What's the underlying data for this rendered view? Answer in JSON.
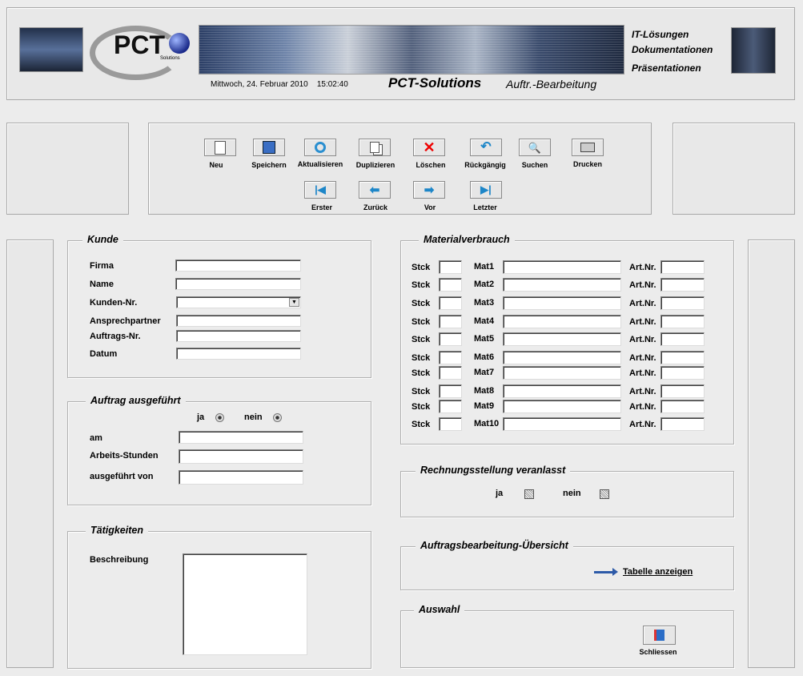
{
  "header": {
    "logo_text": "PCT",
    "logo_sub": "Solutions",
    "datetime": "Mittwoch, 24. Februar 2010    15:02:40",
    "brand": "PCT-Solutions",
    "subtitle": "Auftr.-Bearbeitung",
    "services": [
      "IT-Lösungen",
      "Dokumentationen",
      "Präsentationen"
    ]
  },
  "toolbar": {
    "row1": [
      "Neu",
      "Speichern",
      "Aktualisieren",
      "Duplizieren",
      "Löschen",
      "Rückgängig",
      "Suchen",
      "Drucken"
    ],
    "row2": [
      "Erster",
      "Zurück",
      "Vor",
      "Letzter"
    ]
  },
  "kunde": {
    "title": "Kunde",
    "firma": "Firma",
    "name": "Name",
    "kunden_nr": "Kunden-Nr.",
    "ansprechpartner": "Ansprechpartner",
    "auftrags_nr": "Auftrags-Nr.",
    "datum": "Datum"
  },
  "auftrag": {
    "title": "Auftrag ausgeführt",
    "ja": "ja",
    "nein": "nein",
    "am": "am",
    "stunden": "Arbeits-Stunden",
    "von": "ausgeführt von"
  },
  "taetigkeiten": {
    "title": "Tätigkeiten",
    "beschreibung": "Beschreibung"
  },
  "material": {
    "title": "Materialverbrauch",
    "stck": "Stck",
    "artnr": "Art.Nr.",
    "rows": [
      "Mat1",
      "Mat2",
      "Mat3",
      "Mat4",
      "Mat5",
      "Mat6",
      "Mat7",
      "Mat8",
      "Mat9",
      "Mat10"
    ]
  },
  "rechnung": {
    "title": "Rechnungsstellung veranlasst",
    "ja": "ja",
    "nein": "nein"
  },
  "uebersicht": {
    "title": "Auftragsbearbeitung-Übersicht",
    "link": "Tabelle anzeigen"
  },
  "auswahl": {
    "title": "Auswahl",
    "close": "Schliessen"
  }
}
